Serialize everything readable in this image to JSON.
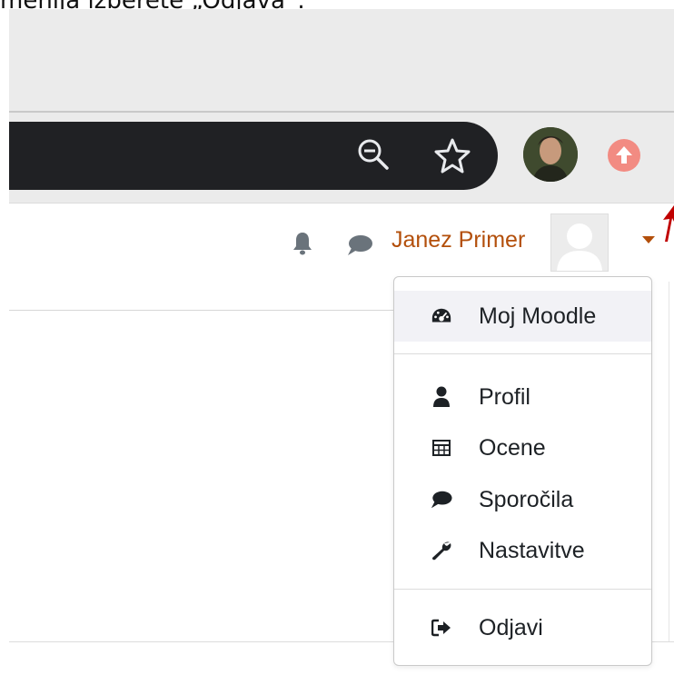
{
  "caption": "menija izberete „Odjava“.",
  "browser": {
    "icons": {
      "zoom": "zoom-out-icon",
      "bookmark": "star-icon",
      "update": "update-arrow-icon"
    }
  },
  "header": {
    "notifications_icon": "bell-icon",
    "messages_icon": "chat-bubble-icon",
    "user_name": "Janez Primer",
    "user_menu_caret": "caret-down-icon"
  },
  "user_menu": {
    "items": [
      {
        "label": "Moj Moodle",
        "icon": "dashboard-icon"
      },
      {
        "label": "Profil",
        "icon": "user-icon"
      },
      {
        "label": "Ocene",
        "icon": "table-icon"
      },
      {
        "label": "Sporočila",
        "icon": "chat-bubble-icon"
      },
      {
        "label": "Nastavitve",
        "icon": "wrench-icon"
      },
      {
        "label": "Odjavi",
        "icon": "sign-out-icon"
      }
    ]
  },
  "colors": {
    "accent": "#b34f0b",
    "menu_hover": "#f2f2f6",
    "address_bar": "#202124",
    "annotation_arrow": "#c00000"
  }
}
